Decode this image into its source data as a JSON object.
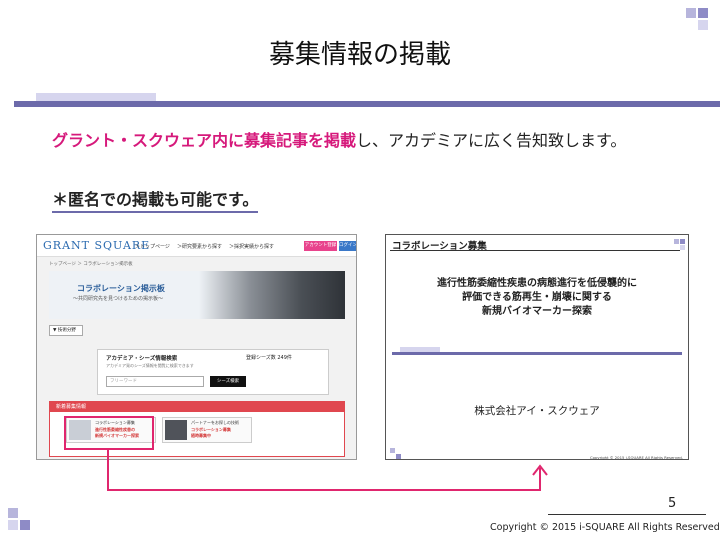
{
  "slide": {
    "title": "募集情報の掲載",
    "lead_highlight": "グラント・スクウェア内に募集記事を掲載",
    "lead_rest": "し、アカデミアに広く告知致します。",
    "note": "＊匿名での掲載も可能です。",
    "page_number": "5",
    "copyright": "Copyright © 2015 i-SQUARE All Rights Reserved."
  },
  "website_screenshot": {
    "logo": "GRANT SQUARE",
    "nav": [
      "＞トップページ",
      "＞研究要素から探す",
      "＞採択実績から探す"
    ],
    "account_button": "アカウント登録",
    "login_button": "ログイン",
    "breadcrumb": "トップページ ＞ コラボレーション掲示板",
    "banner_title": "コラボレーション掲示板",
    "banner_subtitle": "～共同研究先を見つけるための掲示板～",
    "category_select": "▼ 技術分野",
    "search_title": "アカデミア・シーズ情報検索",
    "search_count": "登録シーズ数 249件",
    "search_desc": "アカデミア発のシーズ情報を閲覧に検索できます",
    "search_placeholder": "フリーワード",
    "search_button": "シーズ検索",
    "new_section": "新着募集情報",
    "card1_label": "コラボレーション募集",
    "card1_lines": [
      "進行性筋委縮性疾患の",
      "新規バイオマーカー探索"
    ],
    "card2_label": "パートナーをお探しの技術",
    "card2_lines": [
      "コラボレーション募集",
      "随時募集中"
    ]
  },
  "post_screenshot": {
    "header": "コラボレーション募集",
    "title_lines": [
      "進行性筋委縮性疾患の病態進行を低侵襲的に",
      "評価できる筋再生・崩壊に関する",
      "新規バイオマーカー探索"
    ],
    "company": "株式会社アイ・スクウェア",
    "copyright": "Copyright © 2015 i-SQUARE All Rights Reserved."
  },
  "colors": {
    "accent": "#6c6aaa",
    "highlight": "#d6197b",
    "arrow": "#e0266e"
  }
}
